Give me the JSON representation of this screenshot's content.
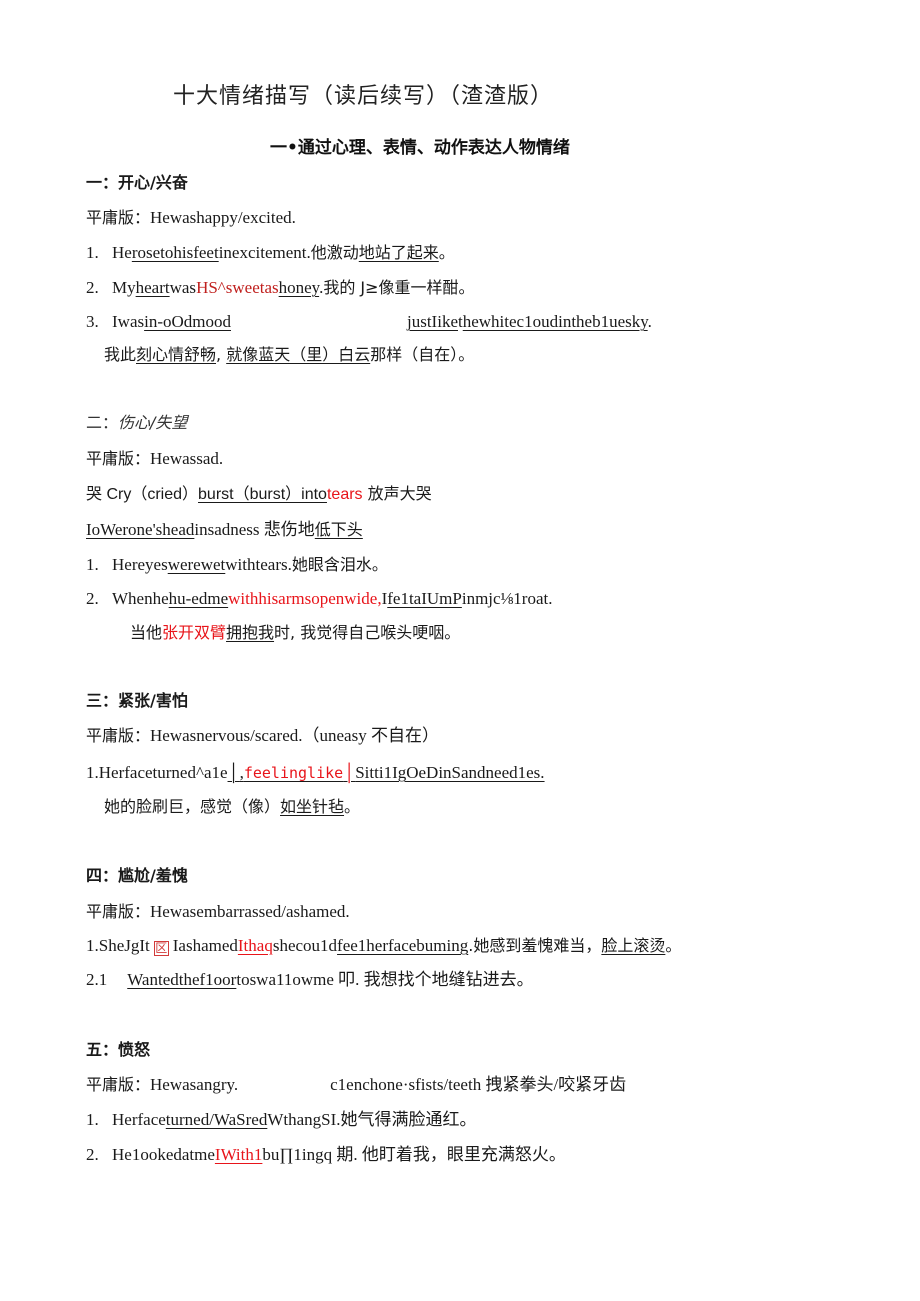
{
  "title": "十大情绪描写（读后续写）（渣渣版）",
  "subtitle": "一•通过心理、表情、动作表达人物情绪",
  "sections": [
    {
      "heading": "一：开心/兴奋",
      "plain_label": "平庸版：",
      "plain_text": "Hewashappy/excited.",
      "items": [
        {
          "num": "1.",
          "a": "He",
          "b": "rosetohisfeet",
          "c": "inexcitement.",
          "d": "他激动",
          "e": "地站了起来",
          "f": "。"
        },
        {
          "num": "2.",
          "a": "My",
          "b": "heart",
          "c": "was",
          "d": "HS^sweetas",
          "e": "honey",
          "f": ".",
          "g": "我的 J≥像重一样酣。"
        },
        {
          "num": "3.",
          "a": "Iwas",
          "b": "in-oOdmood",
          "c": "justIike",
          "d": "t",
          "e": "hewhitec1oudintheb1uesky",
          "f": ".",
          "cn_a": "我此",
          "cn_b": "刻心情舒畅",
          "cn_c": ", ",
          "cn_d": "就像蓝天（里）白云",
          "cn_e": "那样（自在）。"
        }
      ]
    },
    {
      "heading_num": "二：",
      "heading_text": "伤心/失望",
      "plain_label": "平庸版：",
      "plain_text": "Hewassad.",
      "cry_line": {
        "a": "哭 Cry（cried）",
        "b": "burst（burst）into",
        "c": "tears",
        "d": " 放声大哭"
      },
      "lower_line": {
        "a": "IoWerone'shead",
        "b": "insadness 悲伤地",
        "c": "低下头"
      },
      "items": [
        {
          "num": "1.",
          "a": "Hereyes",
          "b": "werewet",
          "c": "withtears.",
          "d": "她眼含泪水。"
        },
        {
          "num": "2.",
          "a": "Whenhe",
          "b": "hu-edme",
          "c": "withhisarmsopenwide,",
          "d": "I",
          "e": "fe1taIUmP",
          "f": "inmjc⅛1roat.",
          "cn_a": "当他",
          "cn_b": "张开双臂",
          "cn_c": "拥抱我",
          "cn_d": "时, 我觉得自己喉头哽咽。"
        }
      ]
    },
    {
      "heading": "三：紧张/害怕",
      "plain_label": "平庸版：",
      "plain_text": "Hewasnervous/scared.（uneasy 不自在）",
      "items": [
        {
          "num": "1.",
          "a": "Herfaceturned^a1e",
          "b": "│",
          "c": ",",
          "d": "feelinglike",
          "e": "│",
          "f": "Sitti1IgOeDinSandneed1es.",
          "cn_a": "她的脸刷巨，感觉（像）",
          "cn_b": "如坐针毡",
          "cn_c": "。"
        }
      ]
    },
    {
      "heading": "四：尴尬/羞愧",
      "plain_label": "平庸版：",
      "plain_text": "Hewasembarrassed/ashamed.",
      "items": [
        {
          "num": "1.",
          "a": "SheJgIt",
          "box": "区",
          "b": "Iashamed",
          "c": "Ithaq",
          "d": "shecou1d",
          "e": "fee1herfacebuming",
          "f": ".她感到羞愧难当，",
          "g": "脸上滚烫",
          "h": "。"
        },
        {
          "num": "2.1",
          "a": "Wantedthef1oor",
          "b": "toswa11owme 叩. 我想找个地缝钻进去。"
        }
      ]
    },
    {
      "heading": "五：愤怒",
      "plain_label": "平庸版：",
      "plain_text": "Hewasangry.",
      "plain_extra": "c1enchone·sfists/teeth 拽紧拳头/咬紧牙齿",
      "items": [
        {
          "num": "1.",
          "a": "Herface",
          "b": "turned/WaSred",
          "c": "WthangSI.她气得满脸通红。"
        },
        {
          "num": "2.",
          "a": "He1ookedatme",
          "b": "IWith1",
          "c": "bu∏1ingq 期. 他盯着我，眼里充满怒火。"
        }
      ]
    }
  ]
}
